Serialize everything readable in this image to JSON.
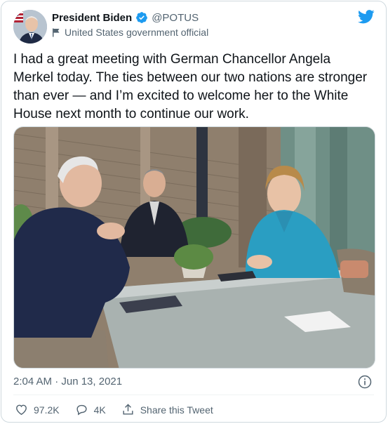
{
  "author": {
    "display_name": "President Biden",
    "handle": "@POTUS",
    "label": "United States government official",
    "verified_icon": "verified-badge-icon",
    "label_icon": "flag-icon"
  },
  "tweet": {
    "text": "I had a great meeting with German Chancellor Angela Merkel today. The ties between our two nations are stronger than ever — and I’m excited to welcome her to the White House next month to continue our work.",
    "timestamp": "2:04 AM · Jun 13, 2021"
  },
  "actions": {
    "like_count": "97.2K",
    "reply_count": "4K",
    "share_label": "Share this Tweet"
  },
  "colors": {
    "brand": "#1d9bf0",
    "text": "#0f1419",
    "muted": "#536471",
    "border": "#cfd9de"
  },
  "icons": [
    "twitter-bird-icon",
    "info-icon",
    "heart-icon",
    "reply-bubble-icon",
    "share-icon"
  ]
}
